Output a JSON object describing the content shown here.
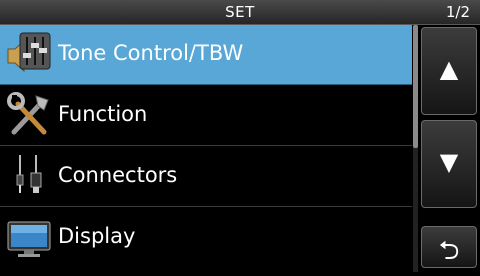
{
  "header": {
    "title": "SET",
    "page_indicator": "1/2"
  },
  "menu": {
    "items": [
      {
        "label": "Tone Control/TBW",
        "icon": "tone-control-icon",
        "selected": true
      },
      {
        "label": "Function",
        "icon": "tools-icon",
        "selected": false
      },
      {
        "label": "Connectors",
        "icon": "connector-cable-icon",
        "selected": false
      },
      {
        "label": "Display",
        "icon": "monitor-icon",
        "selected": false
      }
    ]
  },
  "buttons": {
    "up": {
      "glyph": "▲",
      "icon": "up-arrow-icon"
    },
    "down": {
      "glyph": "▼",
      "icon": "down-arrow-icon"
    },
    "back": {
      "glyph": "⮌",
      "icon": "return-arrow-icon"
    }
  },
  "colors": {
    "selected_row": "#58a7d6",
    "background": "#000000"
  }
}
